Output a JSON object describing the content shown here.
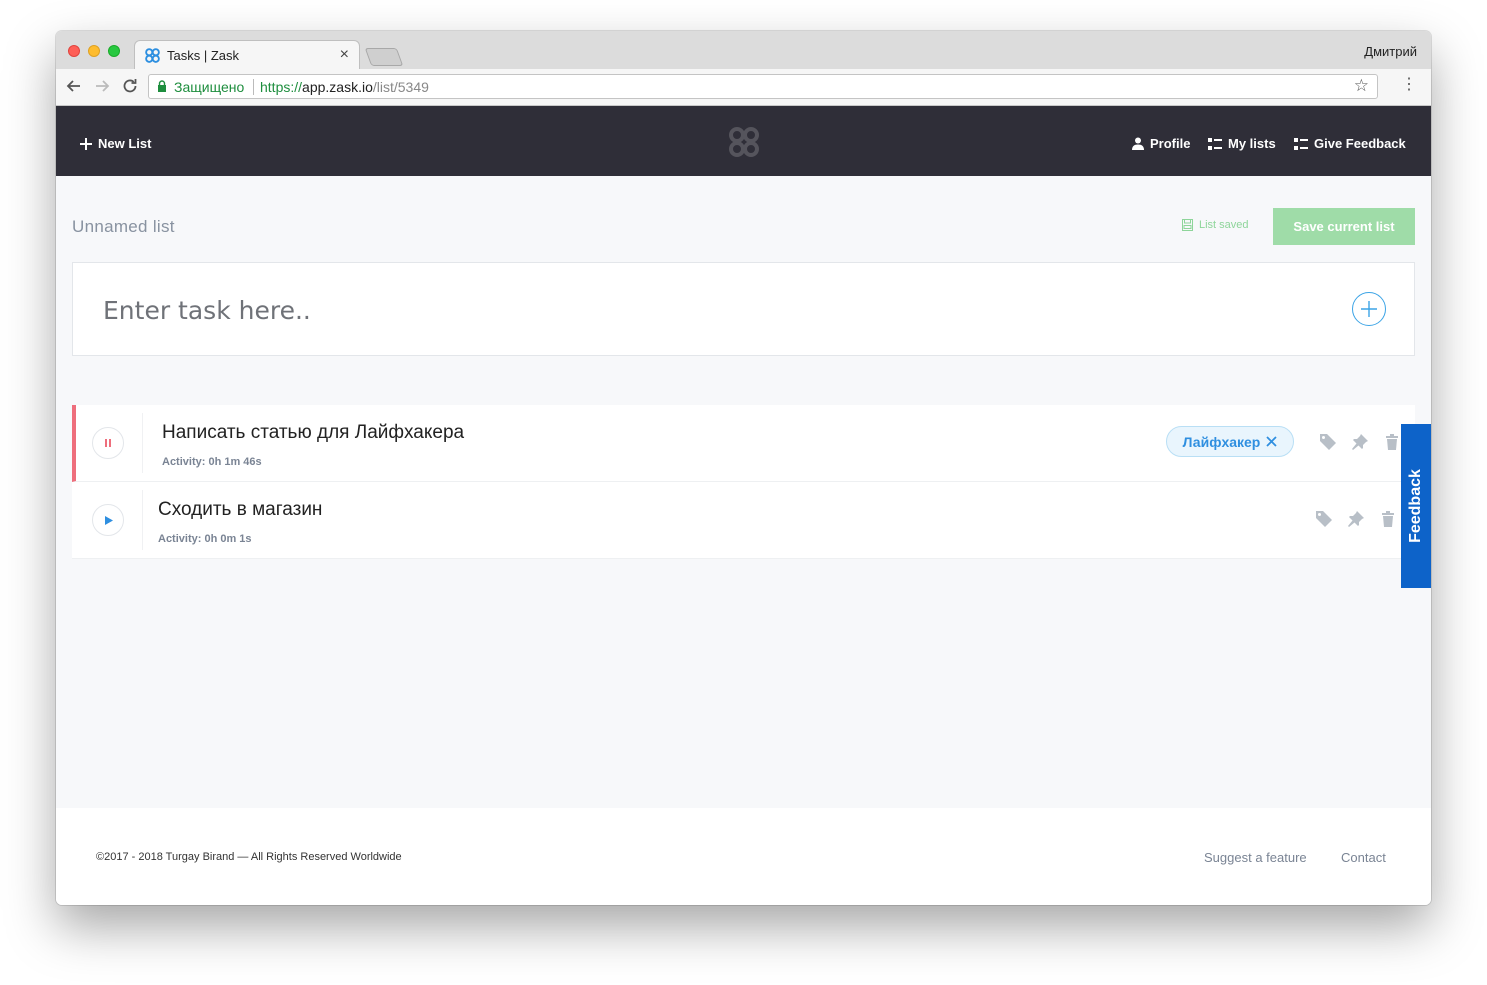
{
  "browser": {
    "tab_title": "Tasks | Zask",
    "tab_close": "×",
    "profile": "Дмитрий",
    "secure_label": "Защищено",
    "url_scheme": "https://",
    "url_host": "app.zask.io",
    "url_path": "/list/5349"
  },
  "header": {
    "new_list": "New List",
    "profile": "Profile",
    "my_lists": "My lists",
    "give_feedback": "Give Feedback"
  },
  "list": {
    "title": "Unnamed list",
    "saved_status": "List saved",
    "save_button": "Save current list",
    "input_placeholder": "Enter task here.."
  },
  "tasks": [
    {
      "title": "Написать статью для Лайфхакера",
      "activity": "Activity: 0h 1m 46s",
      "tag": "Лайфхакер",
      "state": "running"
    },
    {
      "title": "Сходить в магазин",
      "activity": "Activity: 0h 0m 1s",
      "state": "paused"
    }
  ],
  "feedback_tab": "Feedback",
  "footer": {
    "copyright": "©2017 - 2018 Turgay Birand — All Rights Reserved Worldwide",
    "suggest": "Suggest a feature",
    "contact": "Contact"
  },
  "colors": {
    "header_bg": "#2f2e38",
    "accent_blue": "#3ca4e6",
    "save_green": "#9fdca8",
    "active_red": "#ee6e7c",
    "feedback_blue": "#0d63c9"
  }
}
